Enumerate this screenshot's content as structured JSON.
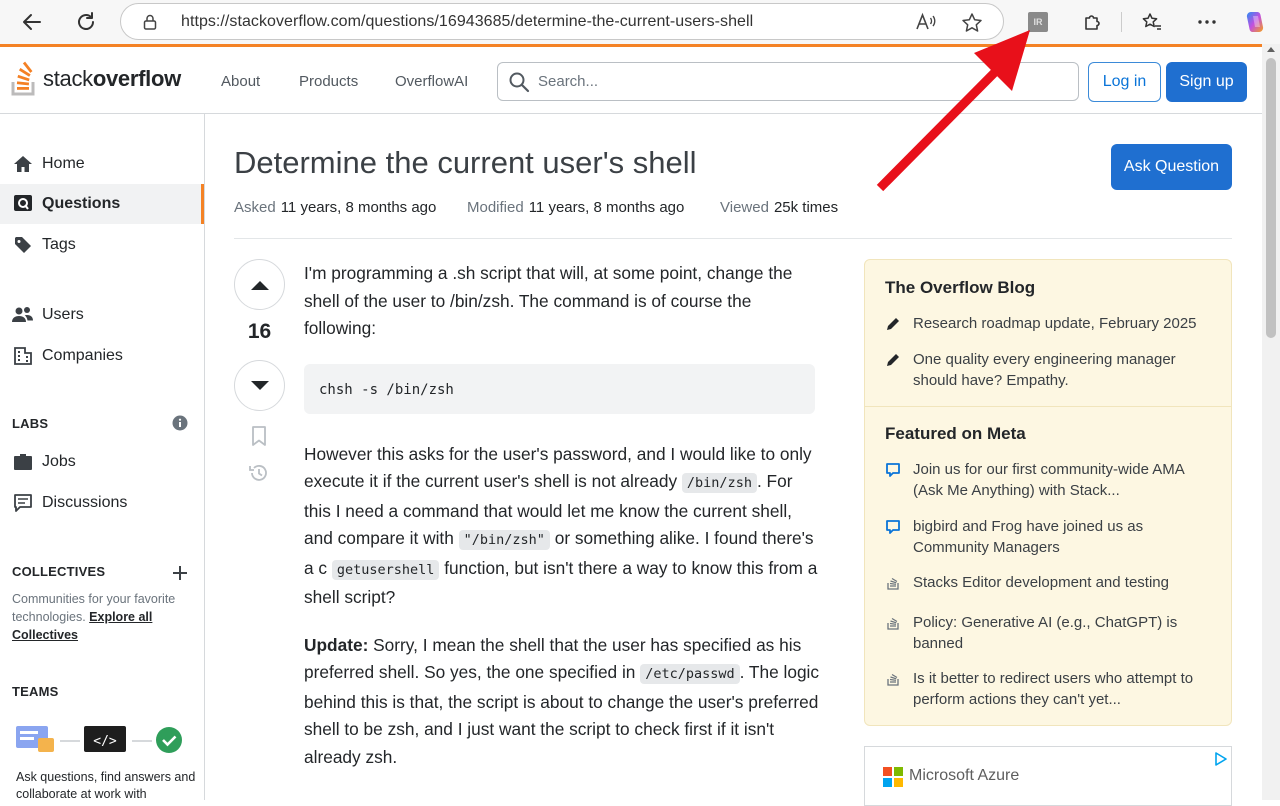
{
  "browser": {
    "url": "https://stackoverflow.com/questions/16943685/determine-the-current-users-shell",
    "extension_badge": "IR"
  },
  "header": {
    "logo_light": "stack",
    "logo_bold": "overflow",
    "nav": [
      "About",
      "Products",
      "OverflowAI"
    ],
    "search_placeholder": "Search...",
    "login": "Log in",
    "signup": "Sign up"
  },
  "sidebar": {
    "home": "Home",
    "questions": "Questions",
    "tags": "Tags",
    "users": "Users",
    "companies": "Companies",
    "labs_heading": "LABS",
    "jobs": "Jobs",
    "discussions": "Discussions",
    "collectives_heading": "COLLECTIVES",
    "collectives_text": "Communities for your favorite technologies.",
    "collectives_link": "Explore all Collectives",
    "teams_heading": "TEAMS",
    "teams_text": "Ask questions, find answers and collaborate at work with"
  },
  "question": {
    "title": "Determine the current user's shell",
    "ask_button": "Ask Question",
    "asked_label": "Asked",
    "asked_value": "11 years, 8 months ago",
    "modified_label": "Modified",
    "modified_value": "11 years, 8 months ago",
    "viewed_label": "Viewed",
    "viewed_value": "25k times",
    "score": "16",
    "p1": "I'm programming a .sh script that will, at some point, change the shell of the user to /bin/zsh. The command is of course the following:",
    "code": "chsh -s /bin/zsh",
    "p2_a": "However this asks for the user's password, and I would like to only execute it if the current user's shell is not already ",
    "p2_code1": "/bin/zsh",
    "p2_b": ". For this I need a command that would let me know the current shell, and compare it with ",
    "p2_code2": "\"/bin/zsh\"",
    "p2_c": " or something alike. I found there's a c ",
    "p2_code3": "getusershell",
    "p2_d": " function, but isn't there a way to know this from a shell script?",
    "p3_bold": "Update:",
    "p3_a": " Sorry, I mean the shell that the user has specified as his preferred shell. So yes, the one specified in ",
    "p3_code": "/etc/passwd",
    "p3_b": ". The logic behind this is that, the script is about to change the user's preferred shell to be zsh, and I just want the script to check first if it isn't already zsh."
  },
  "blog": {
    "heading": "The Overflow Blog",
    "items": [
      "Research roadmap update, February 2025",
      "One quality every engineering manager should have? Empathy."
    ],
    "meta_heading": "Featured on Meta",
    "meta_items": [
      "Join us for our first community-wide AMA (Ask Me Anything) with Stack...",
      "bigbird and Frog have joined us as Community Managers",
      "Stacks Editor development and testing",
      "Policy: Generative AI (e.g., ChatGPT) is banned",
      "Is it better to redirect users who attempt to perform actions they can't yet..."
    ]
  },
  "ad": {
    "brand": "Microsoft Azure"
  },
  "colors": {
    "accent_orange": "#f48225",
    "primary_blue": "#1f6fd0",
    "annotation_red": "#e8101a"
  }
}
